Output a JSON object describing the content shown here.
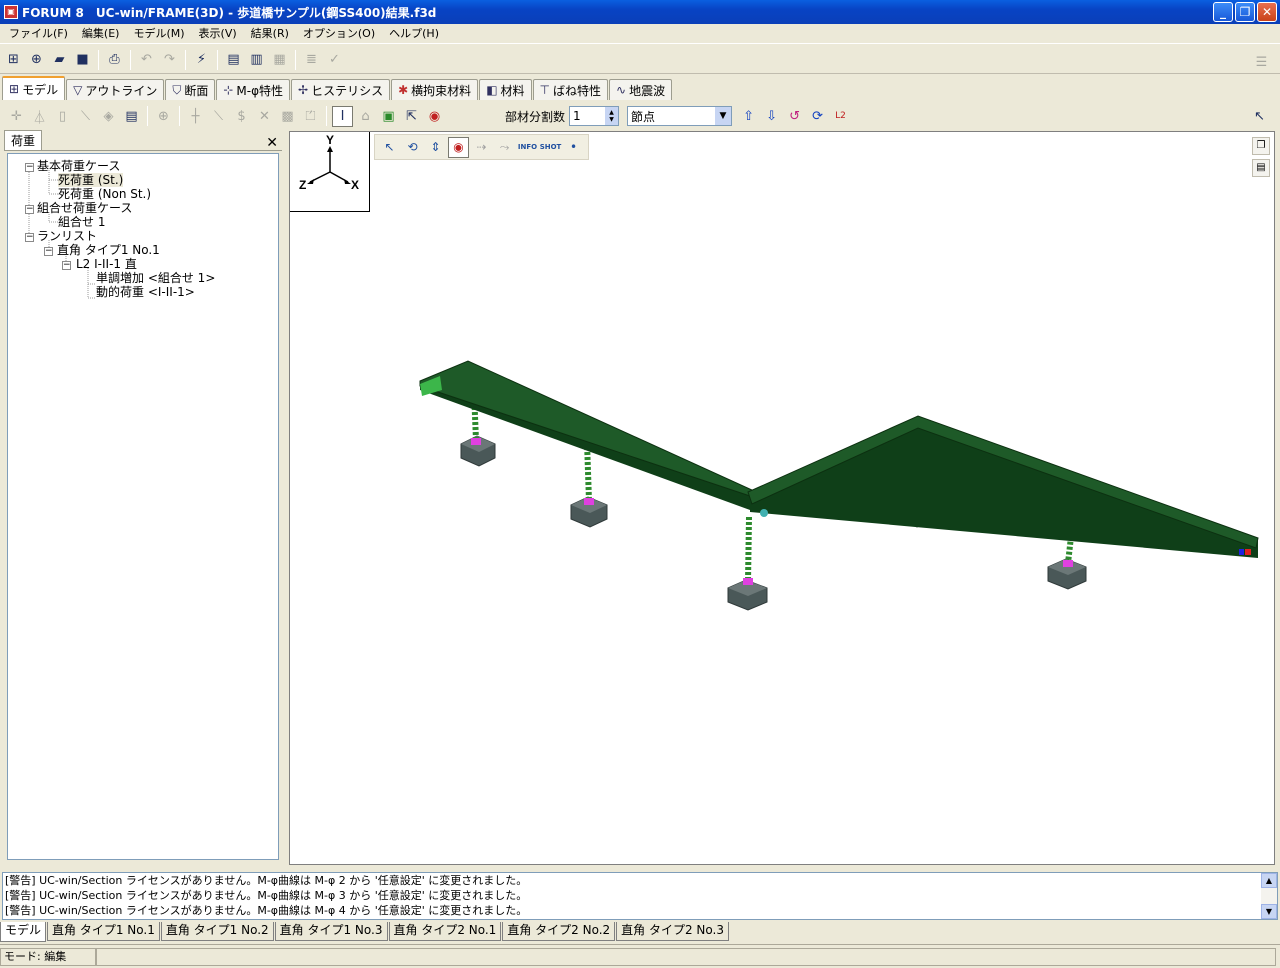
{
  "window": {
    "title": "FORUM 8　UC-win/FRAME(3D) - 歩道橋サンプル(鋼SS400)結果.f3d"
  },
  "menu": [
    "ファイル(F)",
    "編集(E)",
    "モデル(M)",
    "表示(V)",
    "結果(R)",
    "オプション(O)",
    "ヘルプ(H)"
  ],
  "tabs": [
    {
      "label": "モデル",
      "icon": "model-icon"
    },
    {
      "label": "アウトライン",
      "icon": "outline-icon"
    },
    {
      "label": "断面",
      "icon": "section-icon"
    },
    {
      "label": "M-φ特性",
      "icon": "m-phi-icon"
    },
    {
      "label": "ヒステリシス",
      "icon": "hysteresis-icon"
    },
    {
      "label": "横拘束材料",
      "icon": "confinement-icon"
    },
    {
      "label": "材料",
      "icon": "material-icon"
    },
    {
      "label": "ばね特性",
      "icon": "spring-icon"
    },
    {
      "label": "地震波",
      "icon": "wave-icon"
    }
  ],
  "toolbar2": {
    "division_label": "部材分割数",
    "division_value": "1",
    "select_value": "節点"
  },
  "panel": {
    "tab": "荷重",
    "tree": {
      "basic": "基本荷重ケース",
      "dead_st": "死荷重 (St.)",
      "dead_nonst": "死荷重 (Non St.)",
      "combo": "組合せ荷重ケース",
      "combo1": "組合せ 1",
      "runlist": "ランリスト",
      "run1": "直角 タイプ1 No.1",
      "l2": "L2 I-II-1 直",
      "mono": "単調増加 <組合せ 1>",
      "dyn": "動的荷重 <I-II-1>"
    }
  },
  "viewport": {
    "axis_y": "Y",
    "axis_z": "Z",
    "axis_x": "X",
    "tool_info": "INFO",
    "tool_shot": "SHOT"
  },
  "messages": [
    "[警告] UC-win/Section ライセンスがありません。M-φ曲線は M-φ 2 から '任意設定' に変更されました。",
    "[警告] UC-win/Section ライセンスがありません。M-φ曲線は M-φ 3 から '任意設定' に変更されました。",
    "[警告] UC-win/Section ライセンスがありません。M-φ曲線は M-φ 4 から '任意設定' に変更されました。"
  ],
  "bottom_tabs": [
    "モデル",
    "直角 タイプ1 No.1",
    "直角 タイプ1 No.2",
    "直角 タイプ1 No.3",
    "直角 タイプ2 No.1",
    "直角 タイプ2 No.2",
    "直角 タイプ2 No.3"
  ],
  "status": {
    "mode": "モード: 編集"
  },
  "colors": {
    "girder": "#1e5a28",
    "pier": "#2d8a2d",
    "footing": "#4a5858",
    "bearing": "#e040e0"
  }
}
